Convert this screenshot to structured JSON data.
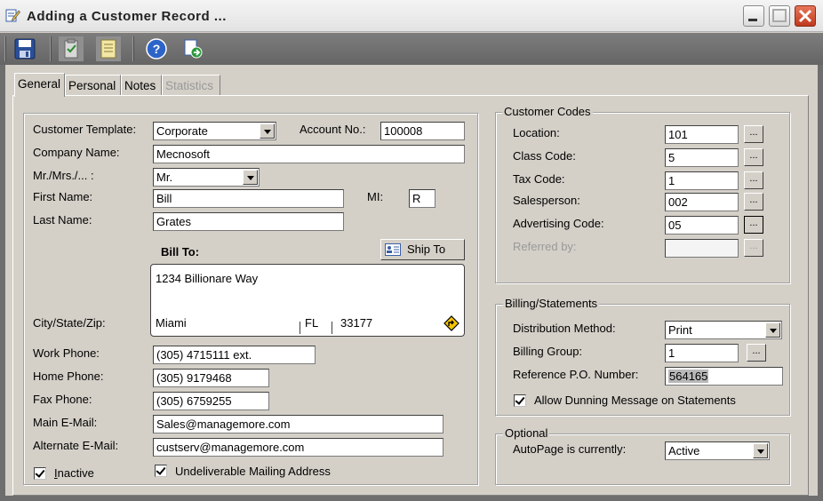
{
  "window": {
    "title": "Adding a Customer Record ..."
  },
  "toolbar": {
    "buttons": [
      {
        "icon": "save-icon"
      },
      {
        "icon": "clipboard-icon"
      },
      {
        "icon": "notebook-icon"
      },
      {
        "icon": "help-icon"
      },
      {
        "icon": "export-icon"
      }
    ]
  },
  "tabs": [
    {
      "label": "General",
      "active": true
    },
    {
      "label": "Personal"
    },
    {
      "label": "Notes"
    },
    {
      "label": "Statistics",
      "disabled": true
    }
  ],
  "general": {
    "customer_template": {
      "label": "Customer Template:",
      "value": "Corporate"
    },
    "account_no": {
      "label": "Account No.:",
      "value": "100008"
    },
    "company_name": {
      "label": "Company Name:",
      "value": "Mecnosoft"
    },
    "salutation": {
      "label": "Mr./Mrs./... :",
      "value": "Mr."
    },
    "first_name": {
      "label": "First Name:",
      "value": "Bill"
    },
    "mi": {
      "label": "MI:",
      "value": "R"
    },
    "last_name": {
      "label": "Last Name:",
      "value": "Grates"
    },
    "bill_to": {
      "label": "Bill To:"
    },
    "ship_to_button": {
      "label": "Ship To"
    },
    "address": {
      "street": "1234 Billionare Way",
      "city_state_zip_label": "City/State/Zip:",
      "city": "Miami",
      "state": "FL",
      "zip": "33177"
    },
    "work_phone": {
      "label": "Work Phone:",
      "value": "(305) 4715111 ext."
    },
    "home_phone": {
      "label": "Home Phone:",
      "value": "(305) 9179468"
    },
    "fax_phone": {
      "label": "Fax Phone:",
      "value": "(305) 6759255"
    },
    "main_email": {
      "label": "Main E-Mail:",
      "value": "Sales@managemore.com"
    },
    "alternate_email": {
      "label": "Alternate E-Mail:",
      "value": "custserv@managemore.com"
    },
    "inactive": {
      "label": "Inactive",
      "checked": true
    },
    "undeliverable": {
      "label": "Undeliverable Mailing Address",
      "checked": true
    }
  },
  "customer_codes": {
    "title": "Customer Codes",
    "location": {
      "label": "Location:",
      "value": "101"
    },
    "class_code": {
      "label": "Class Code:",
      "value": "5"
    },
    "tax_code": {
      "label": "Tax Code:",
      "value": "1"
    },
    "salesperson": {
      "label": "Salesperson:",
      "value": "002"
    },
    "advertising_code": {
      "label": "Advertising Code:",
      "value": "05"
    },
    "referred_by": {
      "label": "Referred by:",
      "value": ""
    },
    "ellipsis": "..."
  },
  "billing": {
    "title": "Billing/Statements",
    "distribution_method": {
      "label": "Distribution Method:",
      "value": "Print"
    },
    "billing_group": {
      "label": "Billing Group:",
      "value": "1"
    },
    "reference_po": {
      "label": "Reference P.O. Number:",
      "value": "564165"
    },
    "allow_dunning": {
      "label": "Allow Dunning Message on Statements",
      "checked": true
    }
  },
  "optional": {
    "title": "Optional",
    "autopage": {
      "label": "AutoPage is currently:",
      "value": "Active"
    }
  }
}
